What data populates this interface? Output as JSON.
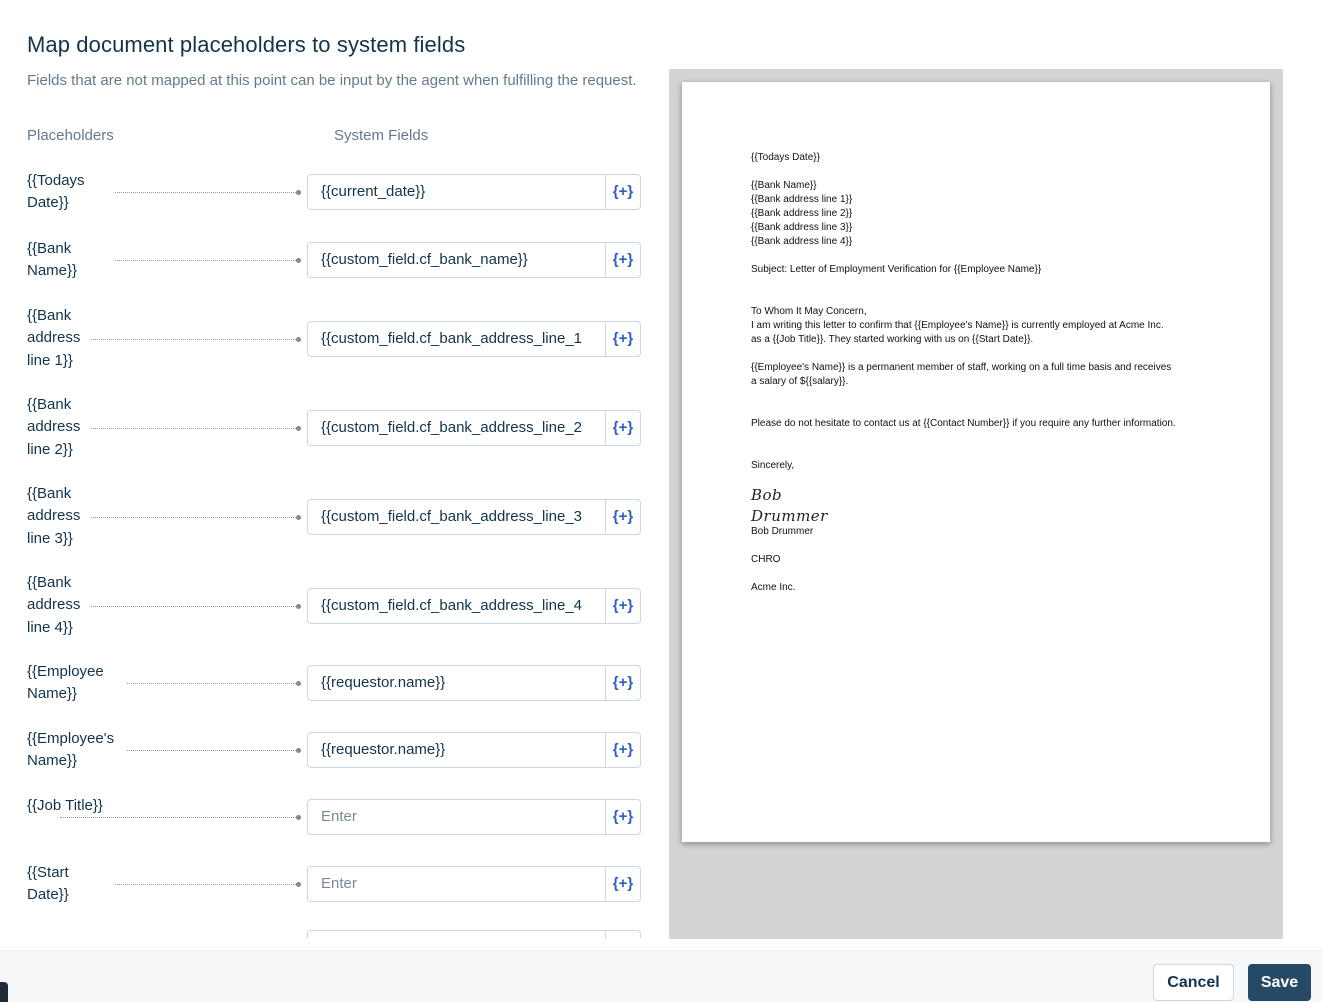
{
  "title": "Map document placeholders to system fields",
  "subtitle": "Fields that are not mapped at this point can be input by the agent when fulfilling the request.",
  "columns": {
    "placeholders": "Placeholders",
    "system_fields": "System Fields"
  },
  "insert_button_label": "{+}",
  "mappings": [
    {
      "placeholder": "{{Todays Date}}",
      "value": "{{current_date}}",
      "placeholder_text": "Enter"
    },
    {
      "placeholder": "{{Bank Name}}",
      "value": "{{custom_field.cf_bank_name}}",
      "placeholder_text": "Enter"
    },
    {
      "placeholder": "{{Bank address line 1}}",
      "value": "{{custom_field.cf_bank_address_line_1",
      "placeholder_text": "Enter"
    },
    {
      "placeholder": "{{Bank address line 2}}",
      "value": "{{custom_field.cf_bank_address_line_2",
      "placeholder_text": "Enter"
    },
    {
      "placeholder": "{{Bank address line 3}}",
      "value": "{{custom_field.cf_bank_address_line_3",
      "placeholder_text": "Enter"
    },
    {
      "placeholder": "{{Bank address line 4}}",
      "value": "{{custom_field.cf_bank_address_line_4",
      "placeholder_text": "Enter"
    },
    {
      "placeholder": "{{Employee Name}}",
      "value": "{{requestor.name}}",
      "placeholder_text": "Enter"
    },
    {
      "placeholder": "{{Employee's Name}}",
      "value": "{{requestor.name}}",
      "placeholder_text": "Enter"
    },
    {
      "placeholder": "{{Job Title}}",
      "value": "",
      "placeholder_text": "Enter"
    },
    {
      "placeholder": "{{Start Date}}",
      "value": "",
      "placeholder_text": "Enter"
    }
  ],
  "document": {
    "date": "{{Todays Date}}",
    "address": "{{Bank Name}}\n{{Bank address line 1}}\n{{Bank address line 2}}\n{{Bank address line 3}}\n{{Bank address line 4}}",
    "subject": "Subject: Letter of Employment Verification for {{Employee Name}}",
    "greeting": "To Whom It May Concern,\nI am writing this letter to confirm that {{Employee's Name}} is currently employed at Acme Inc.\nas a {{Job Title}}. They started working with us on {{Start Date}}.",
    "body": "{{Employee's Name}} is a permanent member of staff, working on a full time basis and receives\na salary of ${{salary}}.",
    "contact": "Please do not hesitate to contact us at {{Contact Number}} if you require any further information.",
    "closing": "Sincerely,",
    "signature": "Bob\nDrummer",
    "signer_name": "Bob Drummer",
    "signer_title": "CHRO",
    "company": "Acme Inc."
  },
  "footer": {
    "cancel_label": "Cancel",
    "save_label": "Save"
  }
}
